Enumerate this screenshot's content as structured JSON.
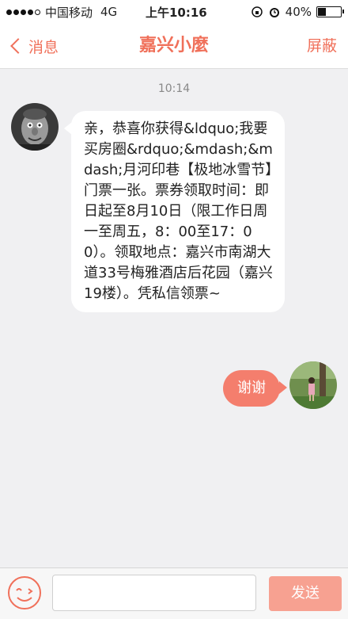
{
  "status_bar": {
    "carrier": "中国移动",
    "network": "4G",
    "time": "上午10:16",
    "battery": "40%",
    "battery_level": 0.4
  },
  "nav": {
    "back_label": "消息",
    "title": "嘉兴小麼",
    "right_label": "屏蔽"
  },
  "chat": {
    "timestamp": "10:14",
    "incoming_message": "亲，恭喜你获得&ldquo;我要买房圈&rdquo;&mdash;&mdash;月河印巷【极地冰雪节】门票一张。票券领取时间：即日起至8月10日（限工作日周一至周五，8：00至17：00）。领取地点：嘉兴市南湖大道33号梅雅酒店后花园（嘉兴19楼）。凭私信领票~",
    "outgoing_message": "谢谢"
  },
  "input_bar": {
    "text_value": "",
    "send_label": "发送"
  },
  "colors": {
    "accent": "#f0705a",
    "bubble_out": "#f47e6d",
    "send_button": "#f7a191"
  }
}
